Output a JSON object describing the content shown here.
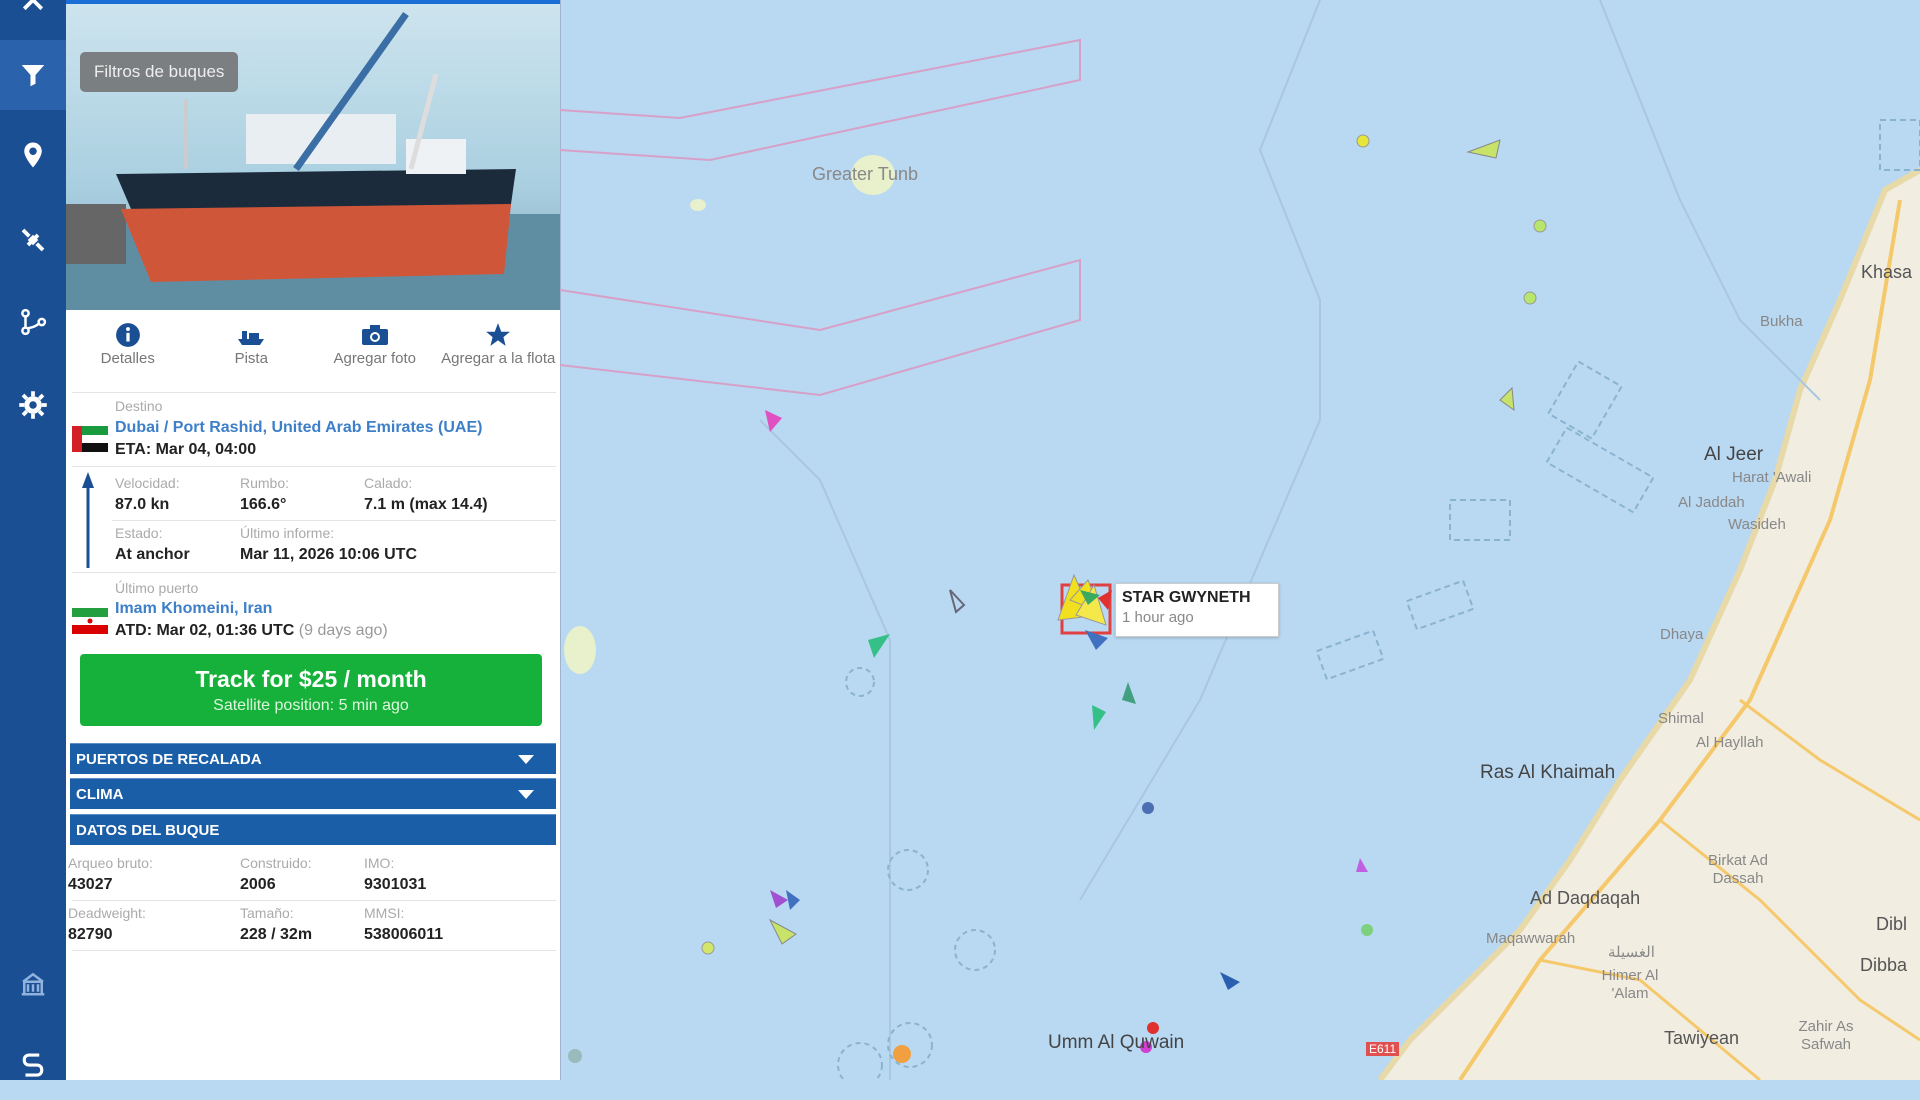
{
  "tooltip": "Filtros de buques",
  "actions": [
    {
      "label": "Detalles",
      "icon": "info-icon"
    },
    {
      "label": "Pista",
      "icon": "ship-track-icon"
    },
    {
      "label": "Agregar foto",
      "icon": "camera-icon"
    },
    {
      "label": "Agregar a la flota",
      "icon": "star-icon"
    }
  ],
  "destination": {
    "label": "Destino",
    "value": "Dubai / Port Rashid, United Arab Emirates (UAE)",
    "eta": "ETA: Mar 04, 04:00"
  },
  "navigation": {
    "speed_label": "Velocidad:",
    "speed": "87.0 kn",
    "course_label": "Rumbo:",
    "course": "166.6°",
    "draught_label": "Calado:",
    "draught": "7.1 m (max 14.4)",
    "status_label": "Estado:",
    "status": "At anchor",
    "last_report_label": "Último informe:",
    "last_report": "Mar 11, 2026 10:06 UTC"
  },
  "last_port": {
    "label": "Último puerto",
    "value": "Imam Khomeini, Iran",
    "atd": "ATD: Mar 02, 01:36 UTC",
    "ago": "(9 days ago)"
  },
  "track_button": {
    "title": "Track for $25 / month",
    "subtitle": "Satellite position: 5 min ago"
  },
  "sections": {
    "ports": "PUERTOS DE RECALADA",
    "weather": "CLIMA",
    "vessel_data": "DATOS DEL BUQUE"
  },
  "vessel": {
    "gross_label": "Arqueo bruto:",
    "gross": "43027",
    "built_label": "Construido:",
    "built": "2006",
    "imo_label": "IMO:",
    "imo": "9301031",
    "dwt_label": "Deadweight:",
    "dwt": "82790",
    "size_label": "Tamaño:",
    "size": "228 / 32m",
    "mmsi_label": "MMSI:",
    "mmsi": "538006011"
  },
  "popup": {
    "name": "STAR GWYNETH",
    "time": "1 hour ago"
  },
  "map_labels": {
    "greater_tunb": "Greater Tunb",
    "khasab": "Khasa",
    "bukha": "Bukha",
    "al_jeer": "Al Jeer",
    "harat_awall": "Harat 'Awali",
    "al_jaddah": "Al Jaddah",
    "wasideh": "Wasideh",
    "dhaya": "Dhaya",
    "shimal": "Shimal",
    "al_hayllah": "Al Hayllah",
    "ras_al_khaimah": "Ras Al Khaimah",
    "birkat": "Birkat Ad Dassah",
    "ad_daqdaqah": "Ad Daqdaqah",
    "maqawwarah": "Maqawwarah",
    "al_ghusailah": "الغسيلة",
    "himer": "Himer Al 'Alam",
    "umm_al_quwain": "Umm Al Quwain",
    "tawiyean": "Tawiyean",
    "zahir_as_safwah": "Zahir As Safwah",
    "dibba": "Dibba",
    "dibb": "Dibl",
    "road_e611": "E611"
  },
  "colors": {
    "rail": "#1b4f93",
    "track_button": "#16b13a",
    "section_bar": "#1b5ea8",
    "link": "#3d7fc8",
    "sea": "#b9d8f2"
  }
}
